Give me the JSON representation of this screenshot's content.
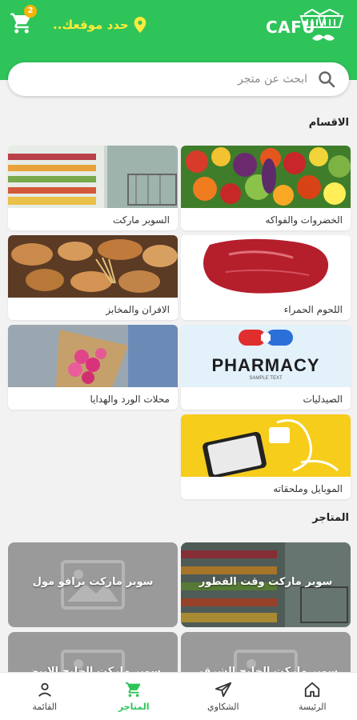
{
  "header": {
    "cart_count": "2",
    "location_label": "حدد موقعك..",
    "logo_text": "CAFU"
  },
  "search": {
    "placeholder": "ابحث عن متجر"
  },
  "sections": {
    "categories_title": "الاقسام",
    "stores_title": "المتاجر"
  },
  "categories": [
    {
      "label": "الخضروات والفواكه"
    },
    {
      "label": "السوبر ماركت"
    },
    {
      "label": "اللحوم الحمراء"
    },
    {
      "label": "الافران والمخابز"
    },
    {
      "label": "الصيدليات"
    },
    {
      "label": "محلات الورد والهدايا"
    },
    {
      "label": "الموبايل وملحقاته"
    }
  ],
  "pharmacy_image": {
    "title": "PHARMACY",
    "subtitle": "SAMPLE TEXT"
  },
  "stores": [
    {
      "name": "سوبر ماركت وقت الفطور"
    },
    {
      "name": "سوبر ماركت برافو مول"
    },
    {
      "name": "سوبر ماركت الخليج الشرقي"
    },
    {
      "name": "سوبر ماركت الخليج الابيض"
    }
  ],
  "bottom_nav": [
    {
      "label": "الرئيسة",
      "icon": "home-icon"
    },
    {
      "label": "الشكاوي",
      "icon": "send-icon"
    },
    {
      "label": "المتاجر",
      "icon": "cart-icon",
      "active": true
    },
    {
      "label": "القائمة",
      "icon": "user-icon"
    }
  ],
  "colors": {
    "brand_green": "#2ec45a",
    "location_yellow": "#ffeb3b",
    "badge": "#f5b400"
  }
}
